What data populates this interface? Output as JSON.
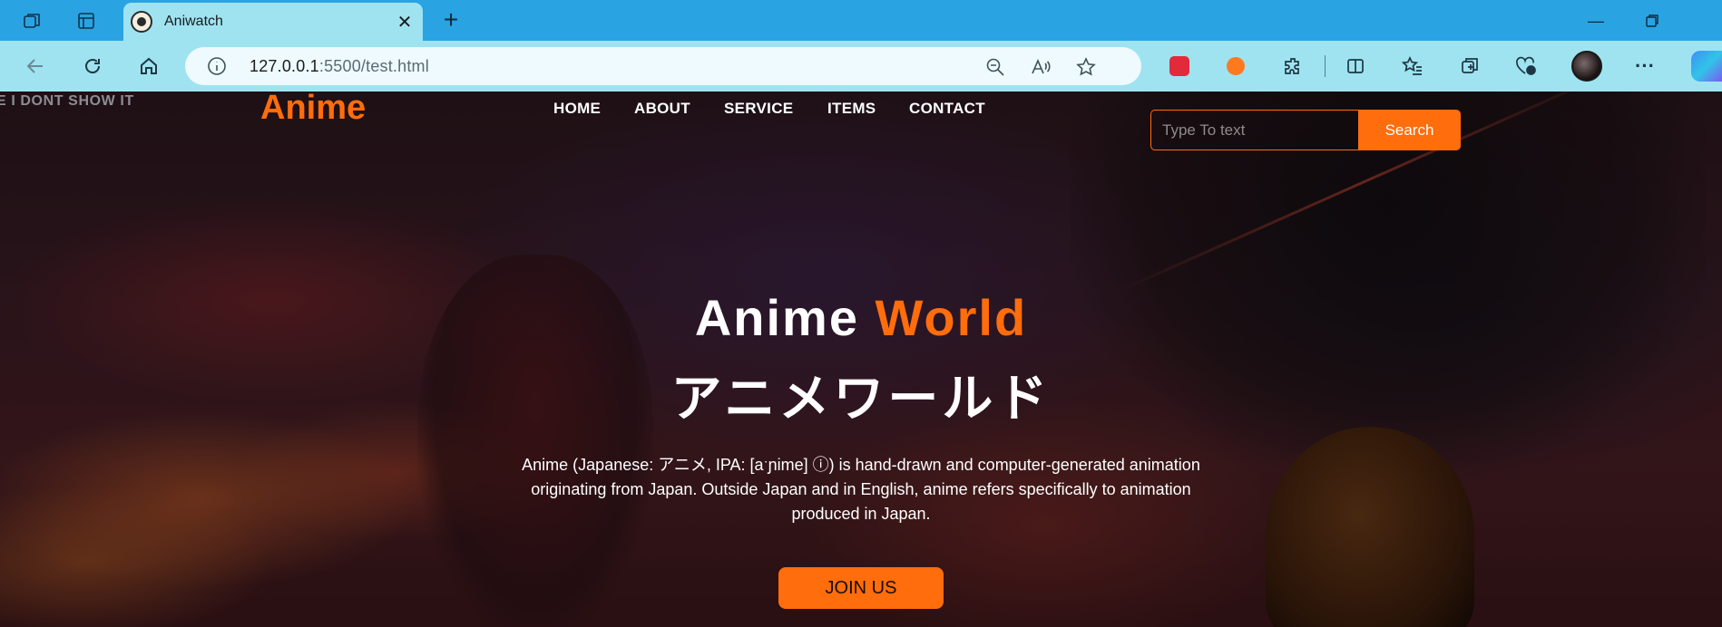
{
  "browser": {
    "tab": {
      "title": "Aniwatch"
    },
    "address": {
      "host": "127.0.0.1",
      "path": ":5500/test.html"
    }
  },
  "site": {
    "watermark": "E I DONT SHOW IT",
    "brand": "Anime",
    "nav": [
      {
        "label": "HOME"
      },
      {
        "label": "ABOUT"
      },
      {
        "label": "SERVICE"
      },
      {
        "label": "ITEMS"
      },
      {
        "label": "CONTACT"
      }
    ],
    "search": {
      "placeholder": "Type To text",
      "button_label": "Search"
    },
    "hero": {
      "title_main": "Anime",
      "title_accent": "World",
      "title_jp": "アニメワールド",
      "description": "Anime (Japanese: アニメ, IPA: [aˑɲime] ⓘ) is hand-drawn and computer-generated animation originating from Japan. Outside Japan and in English, anime refers specifically to animation produced in Japan.",
      "cta_label": "JOIN US"
    }
  },
  "colors": {
    "accent": "#ff6d0c",
    "tabstrip": "#2aa3e2",
    "toolbar": "#9fe3f1"
  }
}
